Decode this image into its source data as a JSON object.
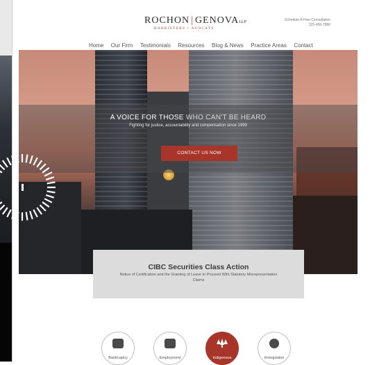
{
  "site": {
    "logo": {
      "left": "ROCHON",
      "right": "GENOVA",
      "suffix": "LLP",
      "tagline": "BARRISTERS • AVOCATS"
    },
    "consultation": {
      "line1": "Schedule A Free Consultation",
      "line2": "325-456-7980"
    },
    "nav": [
      "Home",
      "Our Firm",
      "Testimonials",
      "Resources",
      "Blog & News",
      "Practice Areas",
      "Contact"
    ]
  },
  "hero": {
    "headline_main": "A VOICE FOR THOSE",
    "headline_dim": "WHO CAN'T BE HEARD",
    "subline": "Fighting for justice, accountability and compensation since 1999",
    "cta_label": "CONTACT US NOW"
  },
  "notice": {
    "title": "CIBC Securities Class Action",
    "body": "Notice of Certification and the Granting of Leave to Proceed With Statutory Misrepresentation Claims"
  },
  "practice_areas": [
    {
      "label": "Bankruptcy",
      "icon": "wallet-icon",
      "active": false
    },
    {
      "label": "Employment",
      "icon": "briefcase-icon",
      "active": false
    },
    {
      "label": "Indigenous",
      "icon": "trees-icon",
      "active": true
    },
    {
      "label": "Immigration",
      "icon": "globe-icon",
      "active": false
    }
  ],
  "colors": {
    "accent": "#a8352a",
    "notice_bg": "#dcdcdc"
  },
  "overlay": {
    "spinner": "loading-spinner-icon"
  }
}
